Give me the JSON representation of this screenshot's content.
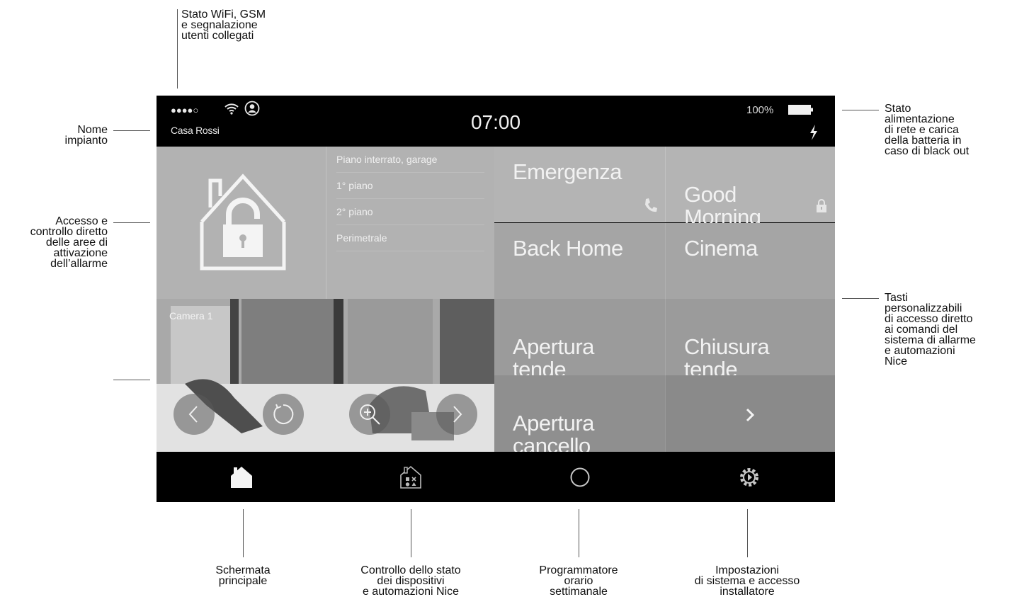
{
  "annotations": {
    "wifi_status": "Stato WiFi, GSM\ne segnalazione\nutenti collegati",
    "system_name": "Nome\nimpianto",
    "alarm_areas": "Accesso e\ncontrollo diretto\ndelle aree di\nattivazione\ndell’allarme",
    "power_status": "Stato\nalimentazione\ndi rete e carica\ndella batteria in\ncaso di black out",
    "custom_keys": "Tasti\npersonalizzabili\ndi accesso diretto\nai comandi del\nsistema di allarme\ne automazioni\nNice",
    "main_screen": "Schermata\nprincipale",
    "device_control": "Controllo dello stato\ndei dispositivi\ne automazioni Nice",
    "scheduler": "Programmatore\norario\nsettimanale",
    "settings": "Impostazioni\ndi sistema e accesso\ninstallatore"
  },
  "status_bar": {
    "signal": "●●●●○",
    "system_name": "Casa Rossi",
    "time": "07:00",
    "battery_percent": "100%"
  },
  "alarm_panel": {
    "areas": [
      "Piano interrato, garage",
      "1° piano",
      "2° piano",
      "Perimetrale"
    ]
  },
  "camera": {
    "label": "Camera 1"
  },
  "shortcuts": {
    "emergency": "Emergenza",
    "good_morning": "Good\nMorning",
    "back_home": "Back Home",
    "cinema": "Cinema",
    "open_curtains": "Apertura\ntende",
    "close_curtains": "Chiusura\ntende",
    "open_gate": "Apertura\ncancello"
  },
  "colors": {
    "tile_light": "#b4b4b4",
    "tile_mid": "#a5a5a5",
    "tile_dark": "#8e8e8e",
    "bar_bg": "#000000"
  }
}
